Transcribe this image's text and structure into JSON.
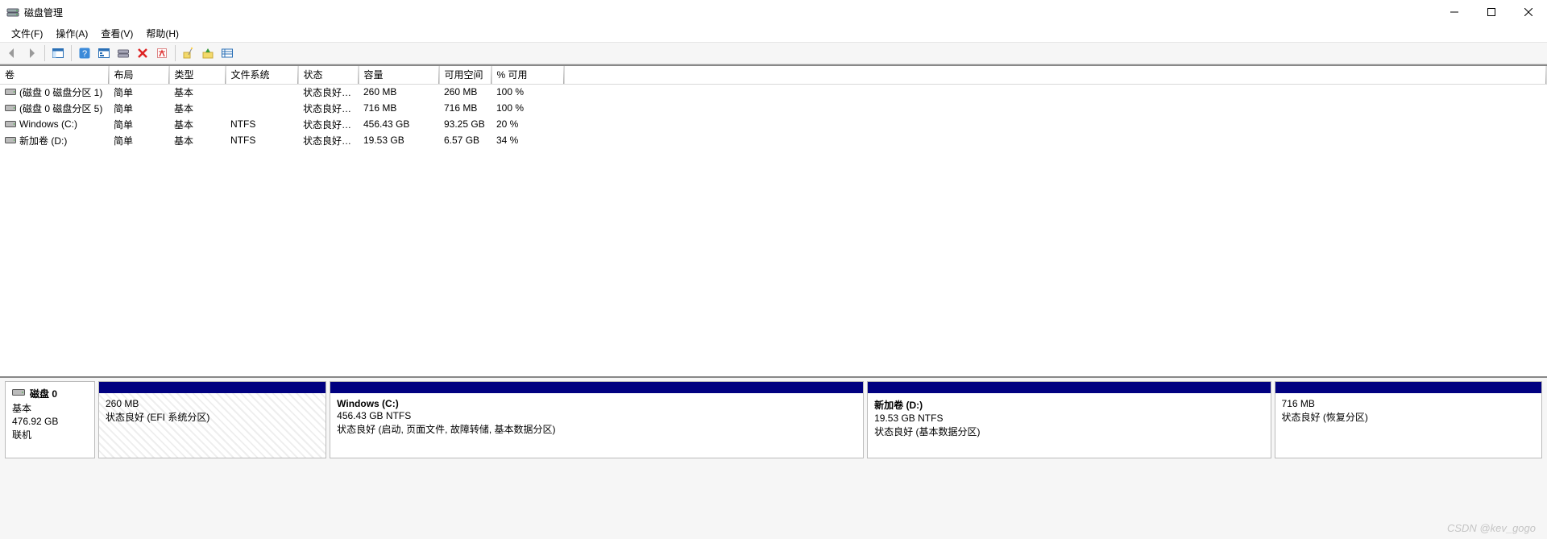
{
  "window": {
    "title": "磁盘管理"
  },
  "menu": {
    "file": "文件(F)",
    "action": "操作(A)",
    "view": "查看(V)",
    "help": "帮助(H)"
  },
  "columns": {
    "volume": "卷",
    "layout": "布局",
    "type": "类型",
    "filesystem": "文件系统",
    "status": "状态",
    "capacity": "容量",
    "freespace": "可用空间",
    "pctfree": "% 可用"
  },
  "volumes": [
    {
      "volume": "(磁盘 0 磁盘分区 1)",
      "layout": "简单",
      "type": "基本",
      "filesystem": "",
      "status": "状态良好 (...",
      "capacity": "260 MB",
      "freespace": "260 MB",
      "pctfree": "100 %"
    },
    {
      "volume": "(磁盘 0 磁盘分区 5)",
      "layout": "简单",
      "type": "基本",
      "filesystem": "",
      "status": "状态良好 (...",
      "capacity": "716 MB",
      "freespace": "716 MB",
      "pctfree": "100 %"
    },
    {
      "volume": "Windows  (C:)",
      "layout": "简单",
      "type": "基本",
      "filesystem": "NTFS",
      "status": "状态良好 (...",
      "capacity": "456.43 GB",
      "freespace": "93.25 GB",
      "pctfree": "20 %"
    },
    {
      "volume": "新加卷 (D:)",
      "layout": "简单",
      "type": "基本",
      "filesystem": "NTFS",
      "status": "状态良好 (...",
      "capacity": "19.53 GB",
      "freespace": "6.57 GB",
      "pctfree": "34 %"
    }
  ],
  "disk": {
    "name": "磁盘 0",
    "type": "基本",
    "size": "476.92 GB",
    "status": "联机",
    "partitions": [
      {
        "title": "",
        "size_fs": "260 MB",
        "status": "状态良好 (EFI 系统分区)",
        "hatched": true,
        "flex": "228"
      },
      {
        "title": "Windows   (C:)",
        "size_fs": "456.43 GB NTFS",
        "status": "状态良好 (启动, 页面文件, 故障转储, 基本数据分区)",
        "hatched": false,
        "flex": "536"
      },
      {
        "title": "新加卷   (D:)",
        "size_fs": "19.53 GB NTFS",
        "status": "状态良好 (基本数据分区)",
        "hatched": false,
        "flex": "405"
      },
      {
        "title": "",
        "size_fs": "716 MB",
        "status": "状态良好 (恢复分区)",
        "hatched": false,
        "flex": "268"
      }
    ]
  },
  "watermark": "CSDN @kev_gogo"
}
